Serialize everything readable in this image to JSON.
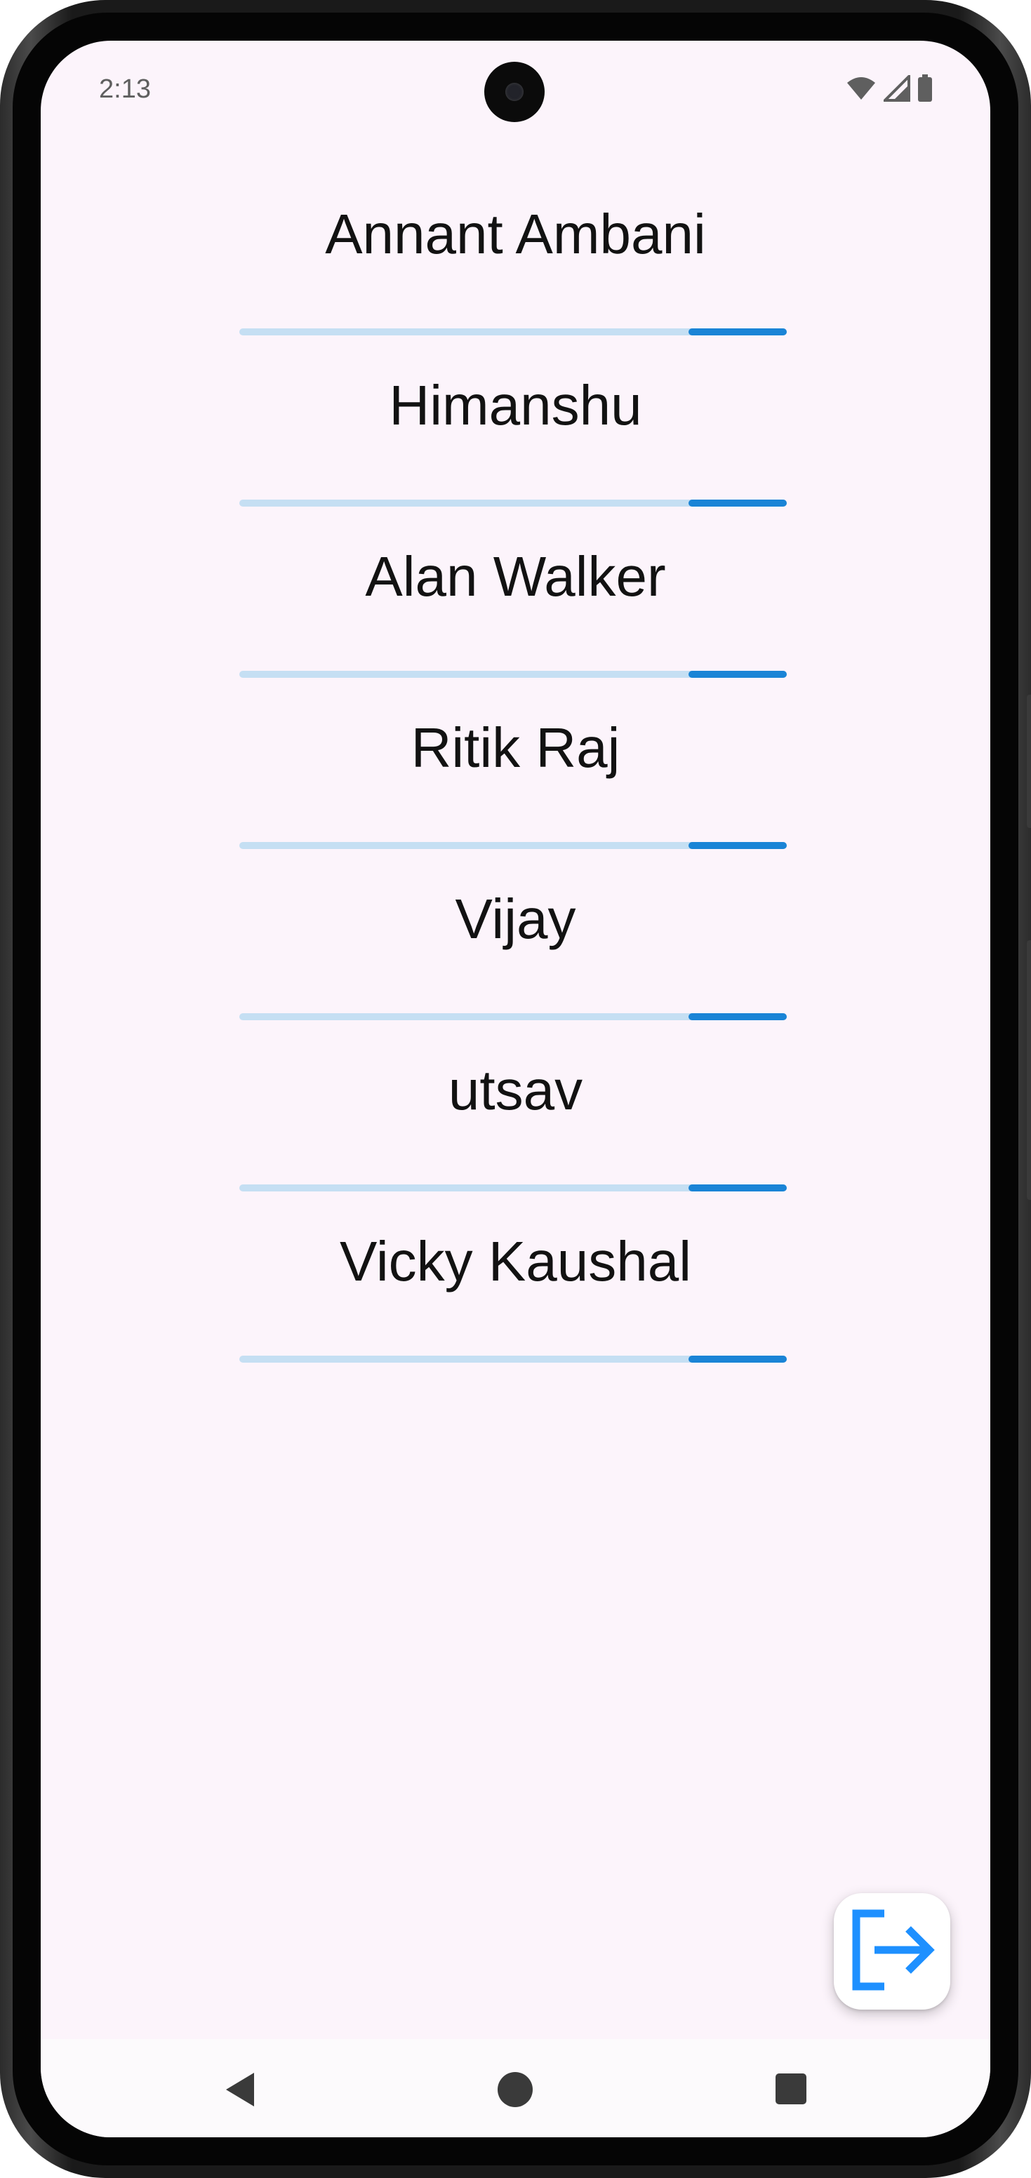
{
  "status_bar": {
    "time": "2:13",
    "icons": [
      "wifi-icon",
      "signal-icon",
      "battery-icon"
    ]
  },
  "list": {
    "items": [
      {
        "name": "Annant Ambani",
        "progress": 0.82
      },
      {
        "name": "Himanshu",
        "progress": 0.82
      },
      {
        "name": "Alan Walker",
        "progress": 0.82
      },
      {
        "name": "Ritik Raj",
        "progress": 0.82
      },
      {
        "name": "Vijay",
        "progress": 0.82
      },
      {
        "name": "utsav",
        "progress": 0.82
      },
      {
        "name": "Vicky Kaushal",
        "progress": 0.82
      }
    ]
  },
  "fab": {
    "icon": "logout-icon"
  },
  "nav_bar": {
    "buttons": [
      "back-icon",
      "home-icon",
      "recents-icon"
    ]
  },
  "colors": {
    "background": "#fcf4fb",
    "track": "#c5dff3",
    "fill": "#1a84d6",
    "fab_icon": "#1e90ff"
  }
}
